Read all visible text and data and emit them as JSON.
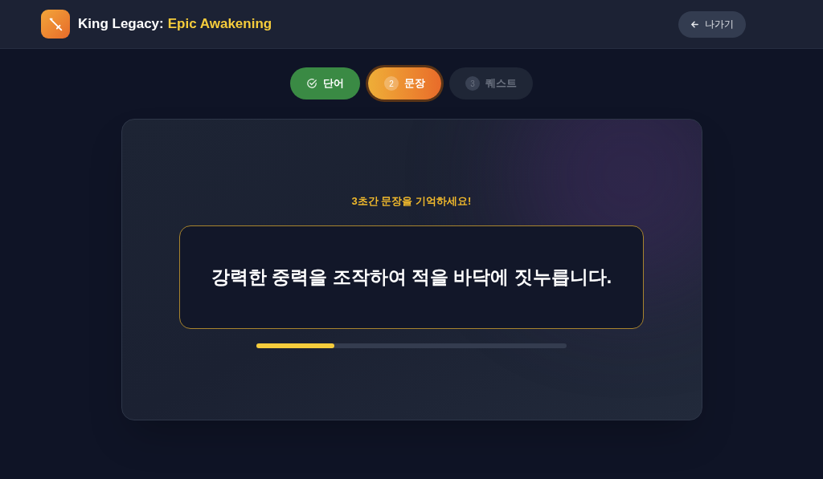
{
  "header": {
    "title": "King Legacy:",
    "title_highlight": "Epic Awakening",
    "exit_button": "나가기"
  },
  "steps": [
    {
      "label": "단어",
      "done": true,
      "selected": false
    },
    {
      "label": "문장",
      "number": "2",
      "done": false,
      "selected": true
    },
    {
      "label": "퀘스트",
      "number": "3",
      "done": false,
      "selected": false
    }
  ],
  "card": {
    "instruction": "3초간 문장을 기억하세요!",
    "sentence": "강력한 중력을 조작하여 적을 바닥에 짓누릅니다.",
    "timer": {
      "level": 0.25
    }
  }
}
